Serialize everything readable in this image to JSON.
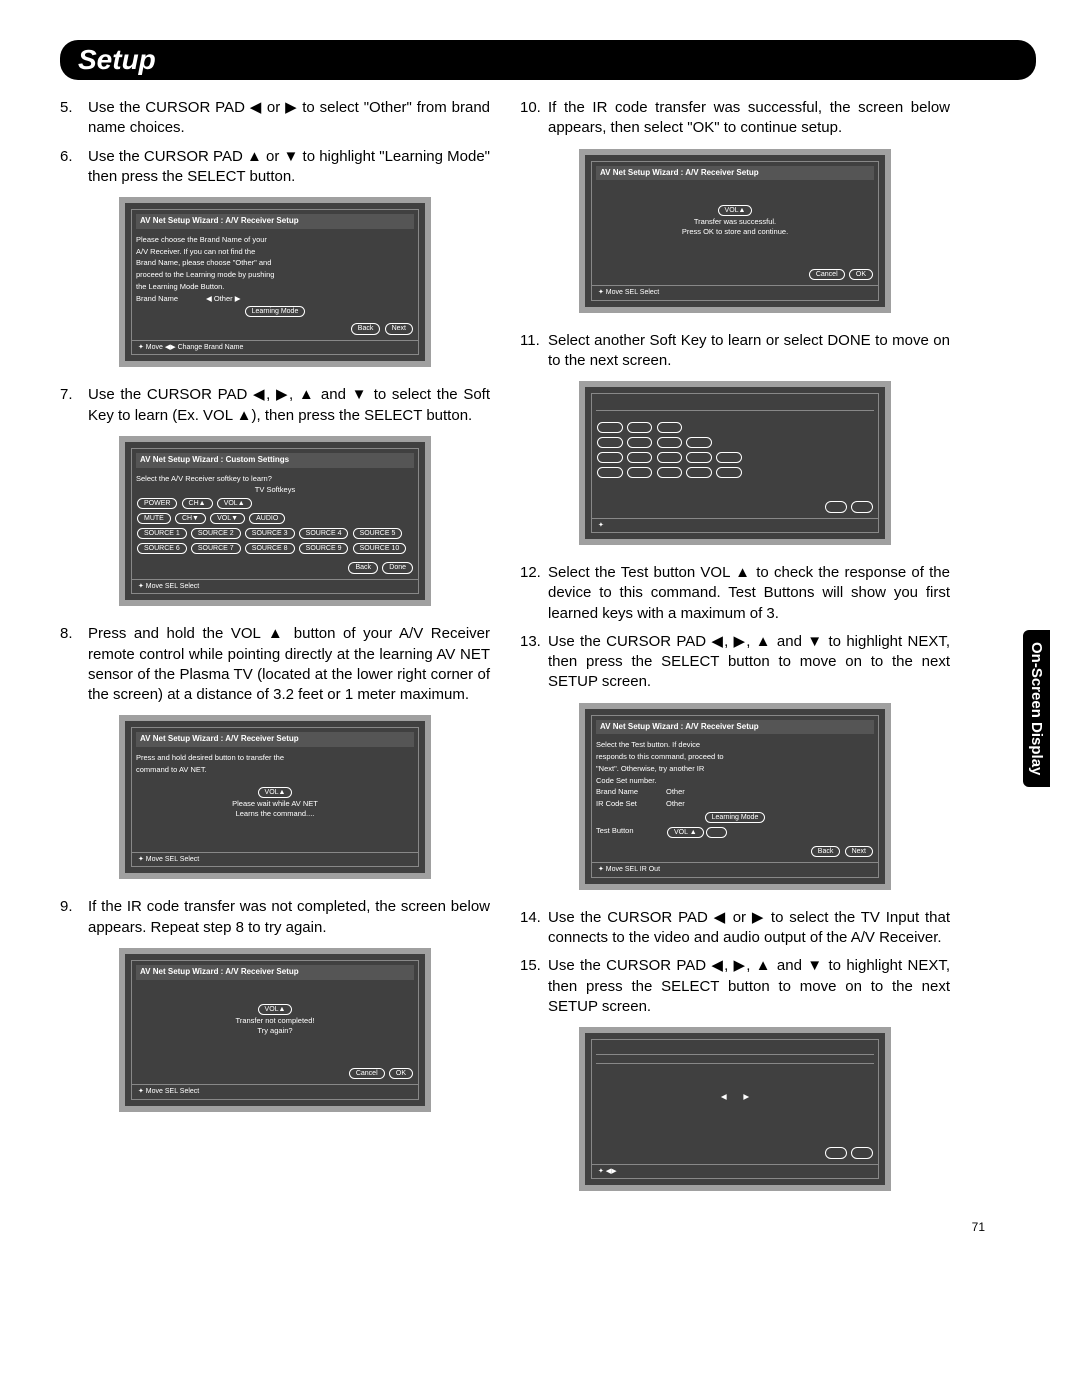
{
  "title": "Setup",
  "side_tab": "On-Screen Display",
  "page_number": "71",
  "arrows": {
    "left": "◀",
    "right": "▶",
    "up": "▲",
    "down": "▼"
  },
  "left": {
    "step5": {
      "num": "5.",
      "text": "Use the CURSOR PAD ◀ or ▶ to select \"Other\" from brand name choices."
    },
    "step6": {
      "num": "6.",
      "text": "Use the CURSOR PAD ▲ or ▼ to highlight \"Learning Mode\" then press the SELECT button."
    },
    "step7": {
      "num": "7.",
      "text": "Use the CURSOR PAD ◀, ▶, ▲ and ▼ to select the Soft Key to learn (Ex. VOL ▲), then press the SELECT button."
    },
    "step8": {
      "num": "8.",
      "text": "Press and hold the VOL ▲ button of your A/V Receiver remote control while pointing directly at the learning AV NET sensor of the Plasma TV (located at the lower right corner of the screen) at a distance of 3.2 feet or 1 meter maximum."
    },
    "step9": {
      "num": "9.",
      "text": "If the IR code transfer was not completed, the screen below appears. Repeat step 8 to try again."
    }
  },
  "right": {
    "step10": {
      "num": "10.",
      "text": "If the IR code transfer was successful, the screen below appears, then select \"OK\" to continue setup."
    },
    "step11": {
      "num": "11.",
      "text": "Select another Soft Key to learn or select DONE to move on to the next screen."
    },
    "step12": {
      "num": "12.",
      "text": "Select the Test button VOL ▲ to check the response of the device to this command. Test Buttons will show you first learned keys with a maximum of 3."
    },
    "step13": {
      "num": "13.",
      "text": "Use the CURSOR PAD ◀, ▶, ▲ and ▼ to highlight NEXT, then press the SELECT button to move on to the next SETUP screen."
    },
    "step14": {
      "num": "14.",
      "text": "Use the CURSOR PAD ◀ or ▶ to select the TV Input that connects to the video and audio output of the A/V Receiver."
    },
    "step15": {
      "num": "15.",
      "text": "Use the CURSOR PAD ◀, ▶, ▲ and ▼ to highlight NEXT, then press the SELECT button to move on to the next SETUP screen."
    }
  },
  "screens": {
    "s6": {
      "title": "AV Net Setup Wizard : A/V Receiver Setup",
      "line1": "Please choose the Brand Name of your",
      "line2": "A/V Receiver. If you can not find the",
      "line3": "Brand Name, please choose \"Other\" and",
      "line4": "proceed to the Learning mode by pushing",
      "line5": "the Learning Mode Button.",
      "brand_label": "Brand Name",
      "brand_value": "◀   Other   ▶",
      "learning": "Learning Mode",
      "back": "Back",
      "next": "Next",
      "hint": "✦ Move   ◀▶ Change Brand Name"
    },
    "s7": {
      "title": "AV Net Setup Wizard : Custom Settings",
      "subtitle": "Select the A/V Receiver softkey to learn?",
      "tv_label": "TV Softkeys",
      "r1": [
        "POWER",
        "CH▲",
        "VOL▲"
      ],
      "r2": [
        "MUTE",
        "CH▼",
        "VOL▼",
        "AUDIO"
      ],
      "r3": [
        "SOURCE 1",
        "SOURCE 2",
        "SOURCE 3",
        "SOURCE 4",
        "SOURCE 5"
      ],
      "r4": [
        "SOURCE 6",
        "SOURCE 7",
        "SOURCE 8",
        "SOURCE 9",
        "SOURCE 10"
      ],
      "back": "Back",
      "done": "Done",
      "hint": "✦ Move   SEL Select"
    },
    "s8": {
      "title": "AV Net Setup Wizard : A/V Receiver Setup",
      "line1": "Press and hold desired button to transfer the",
      "line2": "command to AV NET.",
      "vol": "VOL▲",
      "wait1": "Please wait while AV NET",
      "wait2": "Learns the command....",
      "hint": "✦ Move   SEL Select"
    },
    "s9": {
      "title": "AV Net Setup Wizard : A/V Receiver Setup",
      "vol": "VOL▲",
      "line1": "Transfer not completed!",
      "line2": "Try again?",
      "cancel": "Cancel",
      "ok": "OK",
      "hint": "✦ Move   SEL Select"
    },
    "s10": {
      "title": "AV Net Setup Wizard : A/V Receiver Setup",
      "vol": "VOL▲",
      "line1": "Transfer was successful.",
      "line2": "Press OK to store and continue.",
      "cancel": "Cancel",
      "ok": "OK",
      "hint": "✦ Move   SEL Select"
    },
    "s11": {
      "hint": "✦"
    },
    "s13": {
      "title": "AV Net Setup Wizard : A/V Receiver Setup",
      "l1": "Select the Test button. If device",
      "l2": "responds to this command, proceed to",
      "l3": "\"Next\". Otherwise, try another IR",
      "l4": "Code Set number.",
      "brand_label": "Brand Name",
      "brand_value": "Other",
      "ir_label": "IR Code Set",
      "ir_value": "Other",
      "learning": "Learning Mode",
      "test_label": "Test Button",
      "test_value": "VOL ▲",
      "back": "Back",
      "next": "Next",
      "hint": "✦ Move   SEL IR Out"
    },
    "s15": {
      "hint": "✦        ◀▶"
    }
  }
}
